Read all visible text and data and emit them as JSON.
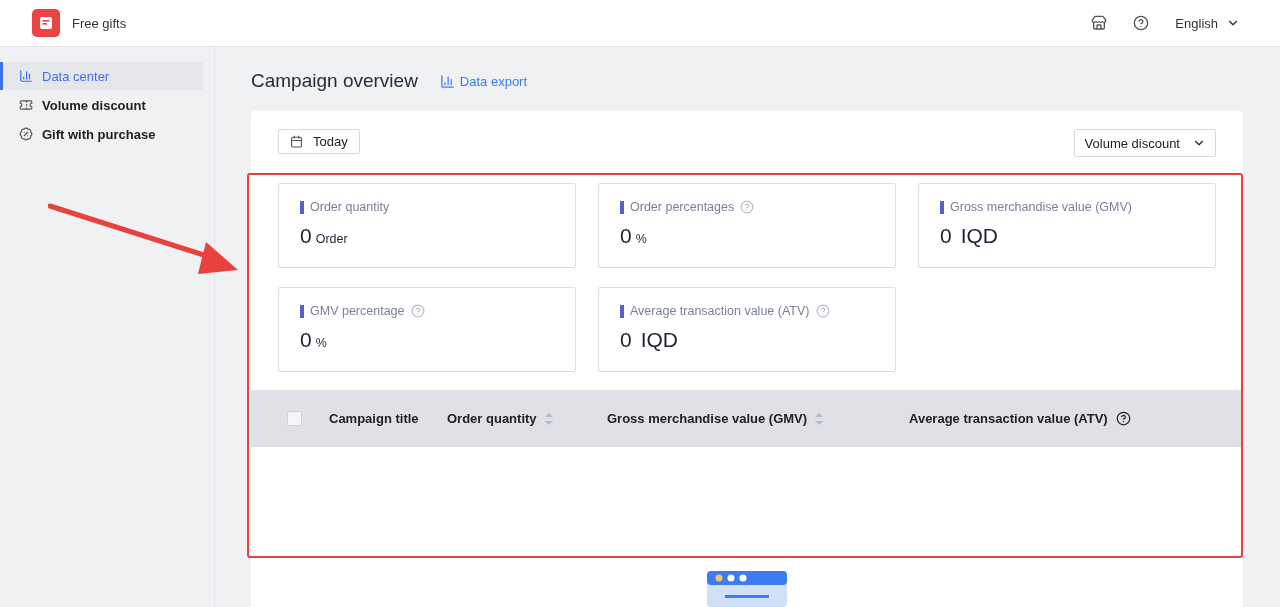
{
  "header": {
    "app_name": "Free gifts",
    "language": "English"
  },
  "sidebar": {
    "items": [
      {
        "label": "Data center",
        "selected": true
      },
      {
        "label": "Volume discount",
        "selected": false
      },
      {
        "label": "Gift with purchase",
        "selected": false
      }
    ]
  },
  "page": {
    "title": "Campaign overview",
    "export_link": "Data export"
  },
  "filters": {
    "date": "Today",
    "campaign_type": "Volume discount"
  },
  "stats": [
    {
      "kind": "small",
      "label": "Order quantity",
      "help": false,
      "value": "0",
      "unit": "Order"
    },
    {
      "kind": "small",
      "label": "Order percentages",
      "help": true,
      "value": "0",
      "unit": "%"
    },
    {
      "kind": "large",
      "label": "Gross merchandise value (GMV)",
      "help": false,
      "value": "0",
      "unit": "IQD"
    },
    {
      "kind": "small",
      "label": "GMV percentage",
      "help": true,
      "value": "0",
      "unit": "%"
    },
    {
      "kind": "large",
      "label": "Average transaction value (ATV)",
      "help": true,
      "value": "0",
      "unit": "IQD"
    }
  ],
  "table": {
    "select_all_checked": false,
    "columns": [
      {
        "label": "Campaign title",
        "sortable": false,
        "help": false
      },
      {
        "label": "Order quantity",
        "sortable": true,
        "help": false
      },
      {
        "label": "Gross merchandise value (GMV)",
        "sortable": true,
        "help": false
      },
      {
        "label": "Average transaction value (ATV)",
        "sortable": false,
        "help": true
      }
    ]
  }
}
